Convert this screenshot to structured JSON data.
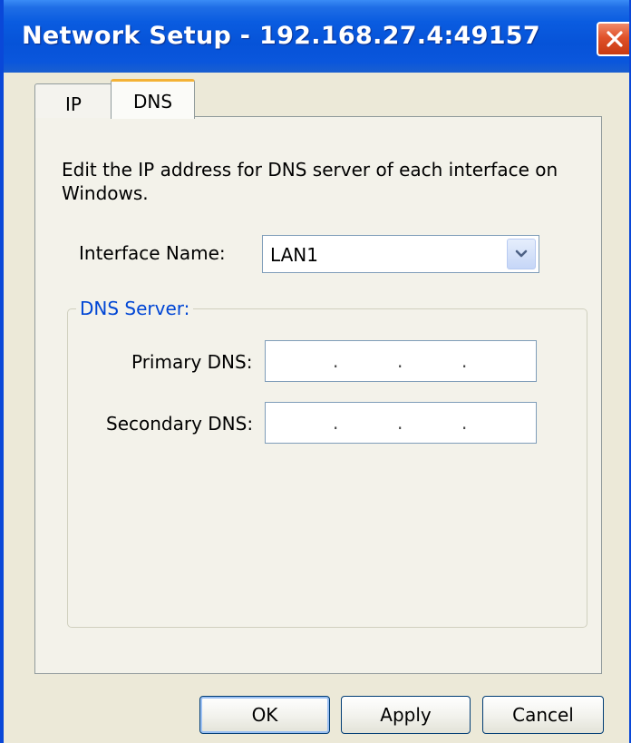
{
  "window": {
    "title": "Network Setup - 192.168.27.4:49157"
  },
  "tabs": [
    {
      "label": "IP"
    },
    {
      "label": "DNS"
    }
  ],
  "dns_page": {
    "description": "Edit the IP address for DNS server of each interface on Windows.",
    "interface_label": "Interface Name:",
    "interface_value": "LAN1",
    "group_title": "DNS Server:",
    "primary_label": "Primary DNS:",
    "primary_value": ". . .",
    "secondary_label": "Secondary DNS:",
    "secondary_value": ". . ."
  },
  "buttons": {
    "ok": "OK",
    "apply": "Apply",
    "cancel": "Cancel"
  },
  "icons": {
    "close": "close-icon",
    "dropdown": "chevron-down-icon"
  },
  "colors": {
    "titlebar": "#0653d8",
    "group_title": "#0046d5",
    "active_tab_accent": "#f4b236",
    "close_button": "#e0522a"
  }
}
